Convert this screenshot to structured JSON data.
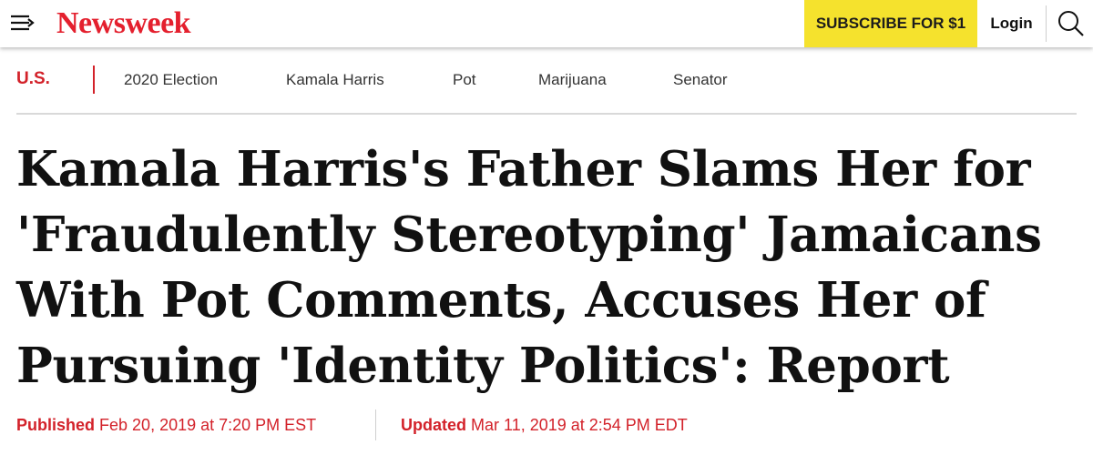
{
  "header": {
    "logo": "Newsweek",
    "subscribe_label": "SUBSCRIBE FOR $1",
    "login_label": "Login"
  },
  "nav": {
    "section": "U.S.",
    "topics": [
      "2020 Election",
      "Kamala Harris",
      "Pot",
      "Marijuana",
      "Senator"
    ]
  },
  "article": {
    "headline": "Kamala Harris's Father Slams Her for 'Fraudulently Stereotyping' Jamaicans With Pot Comments, Accuses Her of Pursuing 'Identity Politics': Report",
    "published_label": "Published",
    "published_date": "Feb 20, 2019 at 7:20 PM EST",
    "updated_label": "Updated",
    "updated_date": "Mar 11, 2019 at 2:54 PM EDT"
  },
  "colors": {
    "brand_red": "#e4202e",
    "accent_red": "#d3222a",
    "subscribe_yellow": "#f5e22d"
  },
  "icons": [
    "menu-icon",
    "search-icon"
  ]
}
